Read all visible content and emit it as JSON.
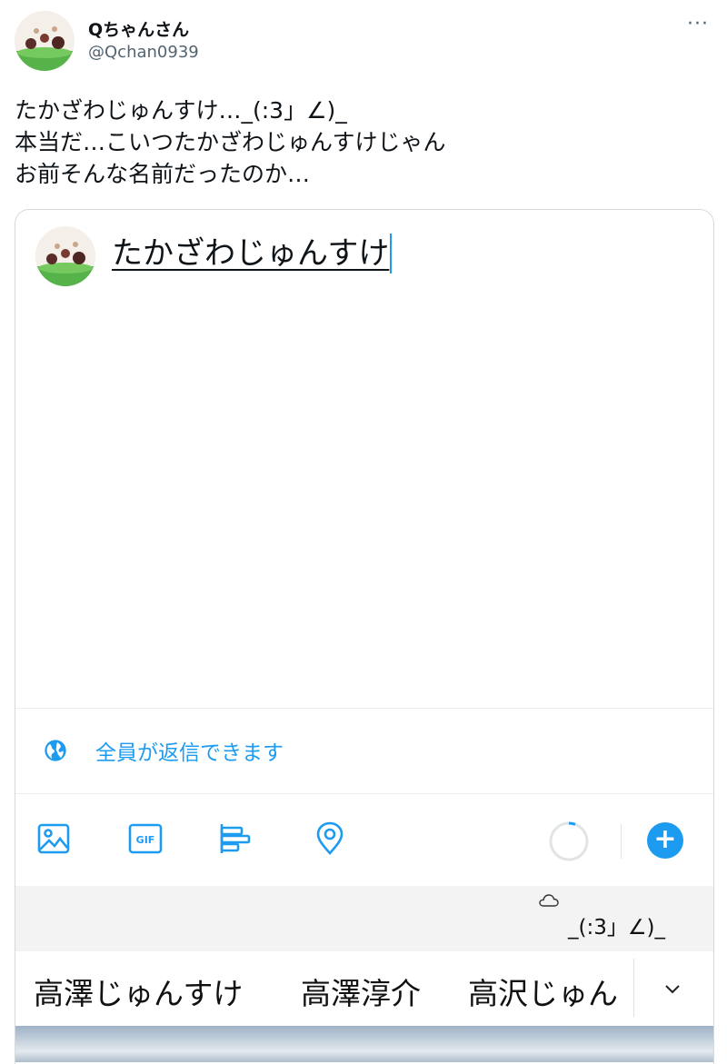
{
  "tweet": {
    "display_name": "Qちゃんさん",
    "handle": "@Qchan0939",
    "more_icon": "more-dots-icon",
    "more_label": "···",
    "lines": [
      "たかざわじゅんすけ…_(:3」∠)_",
      "本当だ…こいつたかざわじゅんすけじゃん",
      "お前そんな名前だったのか…"
    ]
  },
  "compose": {
    "text": "たかざわじゅんすけ",
    "reply_setting": "全員が返信できます",
    "reply_icon": "globe-icon",
    "toolbar": [
      "image-icon",
      "gif-icon",
      "poll-icon",
      "location-icon"
    ],
    "gif_label": "GIF",
    "add_label": "+"
  },
  "ime": {
    "candidate": "_(:3」∠)_",
    "cloud_icon": "cloud-icon",
    "suggestions": [
      "高澤じゅんすけ",
      "高澤淳介",
      "高沢じゅん"
    ],
    "expand_icon": "chevron-down-icon"
  },
  "colors": {
    "accent": "#1d9bf0",
    "text": "#0f1419",
    "secondary": "#536471",
    "ime_bar": "#f3f3f3"
  }
}
